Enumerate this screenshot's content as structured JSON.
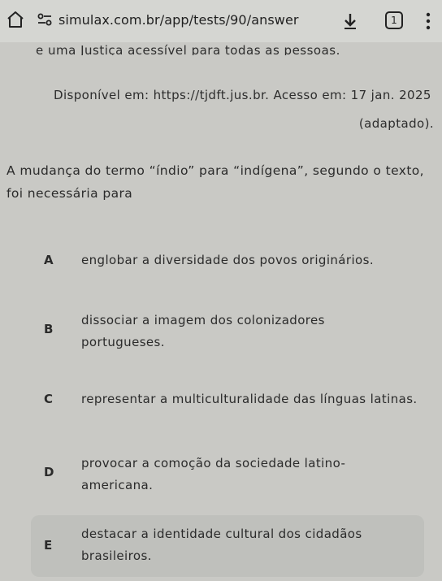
{
  "browser": {
    "url": "simulax.com.br/app/tests/90/answer",
    "tab_count": "1"
  },
  "article": {
    "cut_line": "e uma Justiça acessível para todas as pessoas.",
    "source": "Disponível em: https://tjdft.jus.br. Acesso em: 17 jan. 2025",
    "adapted": "(adaptado)."
  },
  "question": {
    "text": "A mudança do termo “índio” para “indígena”, segundo o texto, foi necessária para"
  },
  "alternatives": [
    {
      "letter": "A",
      "text": "englobar a diversidade dos povos originários."
    },
    {
      "letter": "B",
      "text": "dissociar a imagem dos colonizadores portugueses."
    },
    {
      "letter": "C",
      "text": "representar a multiculturalidade das línguas latinas."
    },
    {
      "letter": "D",
      "text": "provocar a comoção da sociedade latino-americana."
    },
    {
      "letter": "E",
      "text": "destacar a identidade cultural dos cidadãos brasileiros."
    }
  ]
}
